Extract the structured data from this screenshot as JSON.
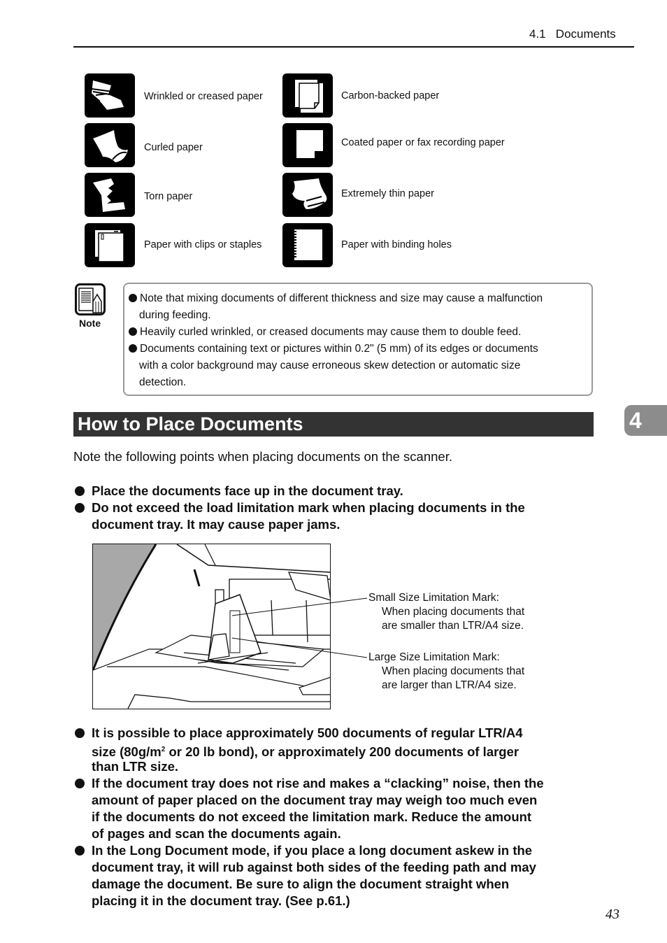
{
  "header": {
    "running_head": "4.1   Documents"
  },
  "icon_grid": {
    "left_column": [
      {
        "icon": "wrinkled-paper-icon",
        "label": "Wrinkled or creased paper"
      },
      {
        "icon": "curled-paper-icon",
        "label": "Curled paper"
      },
      {
        "icon": "torn-paper-icon",
        "label": "Torn paper"
      },
      {
        "icon": "clipped-paper-icon",
        "label": "Paper with clips or staples"
      }
    ],
    "right_column": [
      {
        "icon": "carbon-backed-paper-icon",
        "label": "Carbon-backed paper"
      },
      {
        "icon": "coated-paper-icon",
        "label": "Coated paper or fax recording paper"
      },
      {
        "icon": "thin-paper-icon",
        "label": "Extremely thin paper"
      },
      {
        "icon": "binding-holes-paper-icon",
        "label": "Paper with binding holes"
      }
    ]
  },
  "note": {
    "label": "Note",
    "lines": [
      "Note that mixing documents of different thickness and size may cause a malfunction",
      "during feeding.",
      "Heavily curled wrinkled, or creased documents may cause them to double feed.",
      "Documents containing text or pictures within 0.2\" (5 mm) of its edges or documents",
      "with a color background may cause erroneous skew detection or automatic size",
      "detection."
    ]
  },
  "section": {
    "title": "How to Place Documents",
    "chapter_tab": "4",
    "intro": "Note the following points when placing documents on the scanner.",
    "points_top": [
      [
        "Place the documents face up in the document tray."
      ],
      [
        "Do not exceed the load limitation mark when placing documents in the",
        "document tray. It may cause paper jams."
      ]
    ],
    "figure": {
      "callout_small_title": "Small Size Limitation Mark:",
      "callout_small_l1": "When placing documents that",
      "callout_small_l2": "are smaller than LTR/A4 size.",
      "callout_large_title": "Large Size Limitation Mark:",
      "callout_large_l1": "When placing documents that",
      "callout_large_l2": "are larger than LTR/A4 size."
    },
    "point_capacity": {
      "line1": "It is possible to place approximately 500 documents of regular LTR/A4",
      "line2_pre": "size (80g/m",
      "line2_sup": "2",
      "line2_post": " or 20 lb bond), or approximately 200 documents of larger",
      "line3": "than LTR size."
    },
    "points_bottom": [
      [
        "If the document tray does not rise and makes a “clacking” noise, then the",
        "amount of paper placed on the document tray may weigh too much even",
        "if the documents do not exceed the limitation mark. Reduce the amount",
        "of pages and scan the documents again."
      ],
      [
        "In the Long Document mode, if you place a long document askew in the",
        "document tray, it will rub against both sides of the feeding path and may",
        "damage the document. Be sure to align the document straight when",
        "placing it in the document tray. (See p.61.)"
      ]
    ]
  },
  "footer": {
    "page_number": "43"
  }
}
